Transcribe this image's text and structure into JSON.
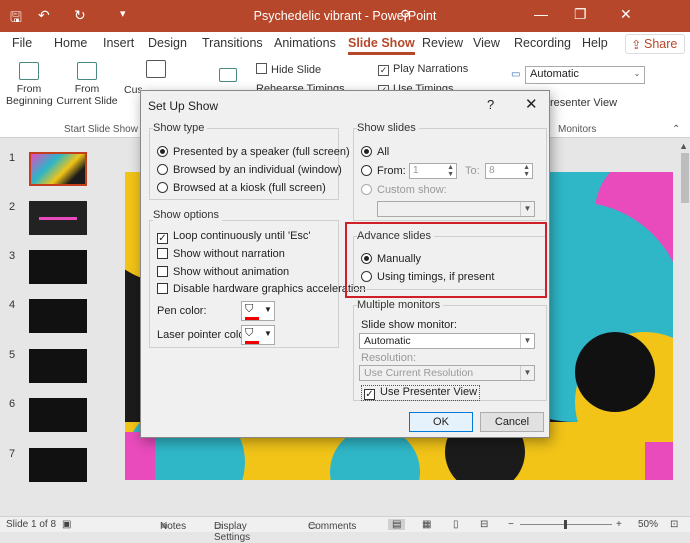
{
  "window": {
    "title": "Psychedelic vibrant  -  PowerPoint"
  },
  "menu_tabs": [
    "File",
    "Home",
    "Insert",
    "Design",
    "Transitions",
    "Animations",
    "Slide Show",
    "Review",
    "View",
    "Recording",
    "Help"
  ],
  "share_label": "Share",
  "ribbon": {
    "from_beginning": "From\nBeginning",
    "from_current": "From\nCurrent Slide",
    "custom": "Cus",
    "group_start": "Start Slide Show",
    "hide_slide": "Hide Slide",
    "rehearse": "Rehearse Timings",
    "play_narrations": "Play Narrations",
    "use_timings": "Use Timings",
    "monitor_select": "Automatic",
    "presenter_view": "resenter View",
    "group_monitors": "Monitors"
  },
  "slides": {
    "numbers": [
      "1",
      "2",
      "3",
      "4",
      "5",
      "6",
      "7"
    ]
  },
  "dialog": {
    "title": "Set Up Show",
    "help": "?",
    "close": "✕",
    "show_type": {
      "legend": "Show type",
      "options": [
        "Presented by a speaker (full screen)",
        "Browsed by an individual (window)",
        "Browsed at a kiosk (full screen)"
      ],
      "selected": 0
    },
    "show_options": {
      "legend": "Show options",
      "loop": "Loop continuously until 'Esc'",
      "no_narration": "Show without narration",
      "no_animation": "Show without animation",
      "disable_hw": "Disable hardware graphics acceleration",
      "pen_color": "Pen color:",
      "laser_color": "Laser pointer color:"
    },
    "show_slides": {
      "legend": "Show slides",
      "all": "All",
      "from": "From:",
      "from_value": "1",
      "to": "To:",
      "to_value": "8",
      "custom_show": "Custom show:"
    },
    "advance_slides": {
      "legend": "Advance slides",
      "manually": "Manually",
      "using_timings": "Using timings, if present"
    },
    "multiple_monitors": {
      "legend": "Multiple monitors",
      "monitor_label": "Slide show monitor:",
      "monitor_value": "Automatic",
      "resolution_label": "Resolution:",
      "resolution_value": "Use Current Resolution",
      "presenter_view": "Use Presenter View"
    },
    "ok": "OK",
    "cancel": "Cancel"
  },
  "status": {
    "slide_of": "Slide 1 of 8",
    "notes": "Notes",
    "display_settings": "Display Settings",
    "comments": "Comments",
    "zoom": "50%"
  },
  "colors": {
    "accent": "#b7472a",
    "highlight": "#d11f27"
  }
}
